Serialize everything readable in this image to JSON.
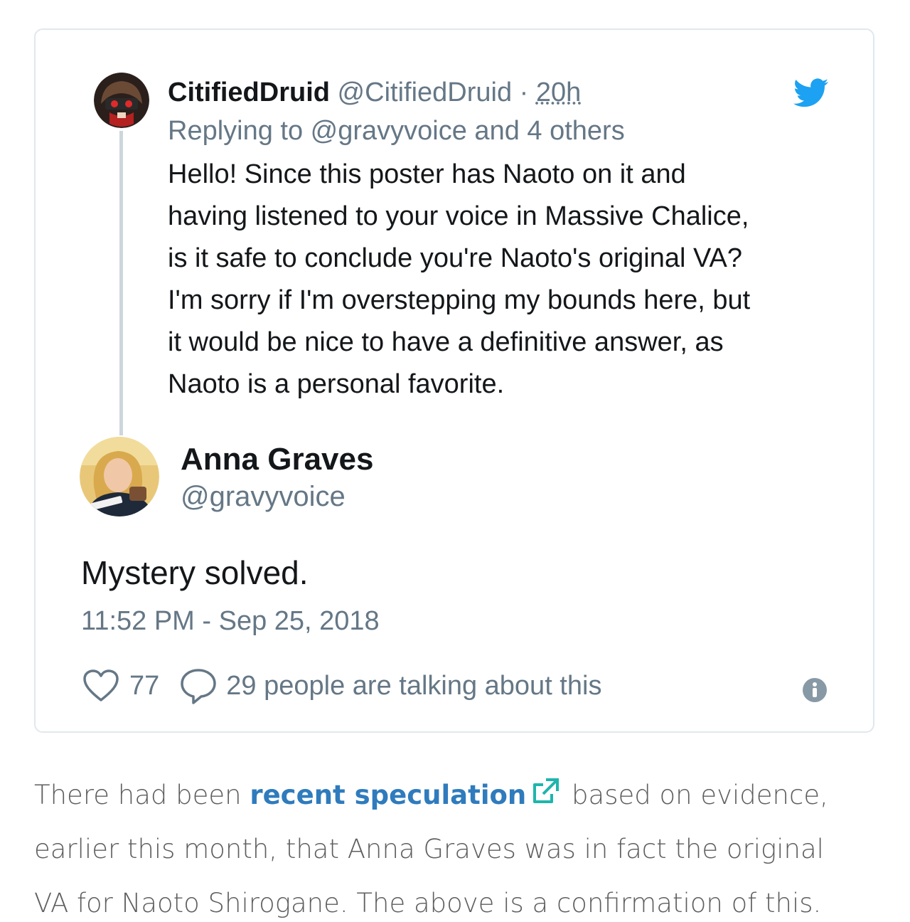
{
  "reply_tweet": {
    "display_name": "CitifiedDruid",
    "handle": "@CitifiedDruid",
    "separator": "·",
    "time_ago": "20h",
    "replying_to": "Replying to @gravyvoice and 4 others",
    "lines": [
      "Hello! Since this poster has Naoto on it and",
      "having listened to your voice in Massive Chalice,",
      "is it safe to conclude you're Naoto's original VA?",
      "I'm sorry if I'm overstepping my bounds here, but",
      "it would be nice to have a definitive answer, as",
      "Naoto is a personal favorite."
    ]
  },
  "main_tweet": {
    "display_name": "Anna Graves",
    "handle": "@gravyvoice",
    "text": "Mystery solved.",
    "timestamp": "11:52 PM - Sep 25, 2018",
    "like_count": "77",
    "talking_text": "29 people are talking about this"
  },
  "article": {
    "prefix": "There had been ",
    "link_text": "recent speculation",
    "line1_rest": " based on evidence,",
    "line2": "earlier this month, that Anna Graves was in fact the original",
    "line3": "VA for Naoto Shirogane. The above is a confirmation of this."
  },
  "colors": {
    "twitter_blue": "#1da1f2",
    "secondary_text": "#657786",
    "link_blue": "#2f7bbd",
    "external_icon": "#1fb5ac"
  },
  "icons": {
    "brand": "twitter-bird-icon",
    "like": "heart-icon",
    "reply": "speech-bubble-icon",
    "info": "info-icon",
    "external_link": "external-link-icon"
  }
}
